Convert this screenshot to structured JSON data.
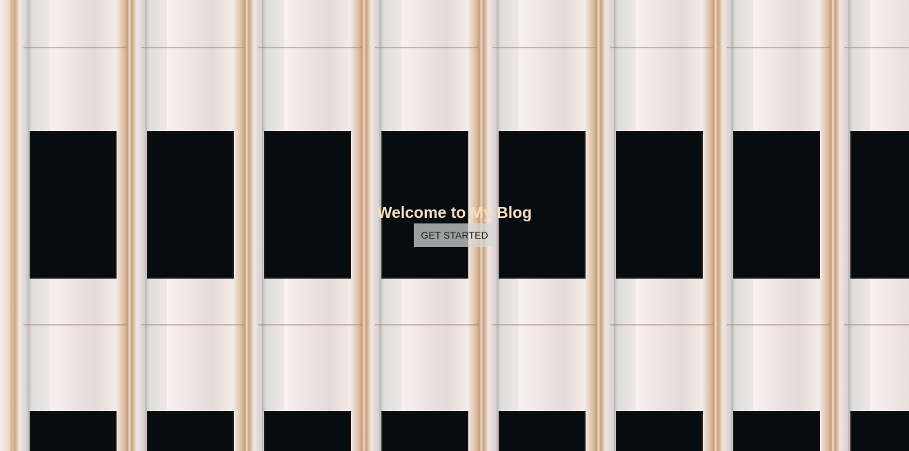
{
  "hero": {
    "title": "Welcome to My Blog",
    "cta_label": "GET STARTED",
    "background_description_icon": "building-facade-image",
    "title_color": "#f6dfbf",
    "window_color": "#060c10"
  }
}
